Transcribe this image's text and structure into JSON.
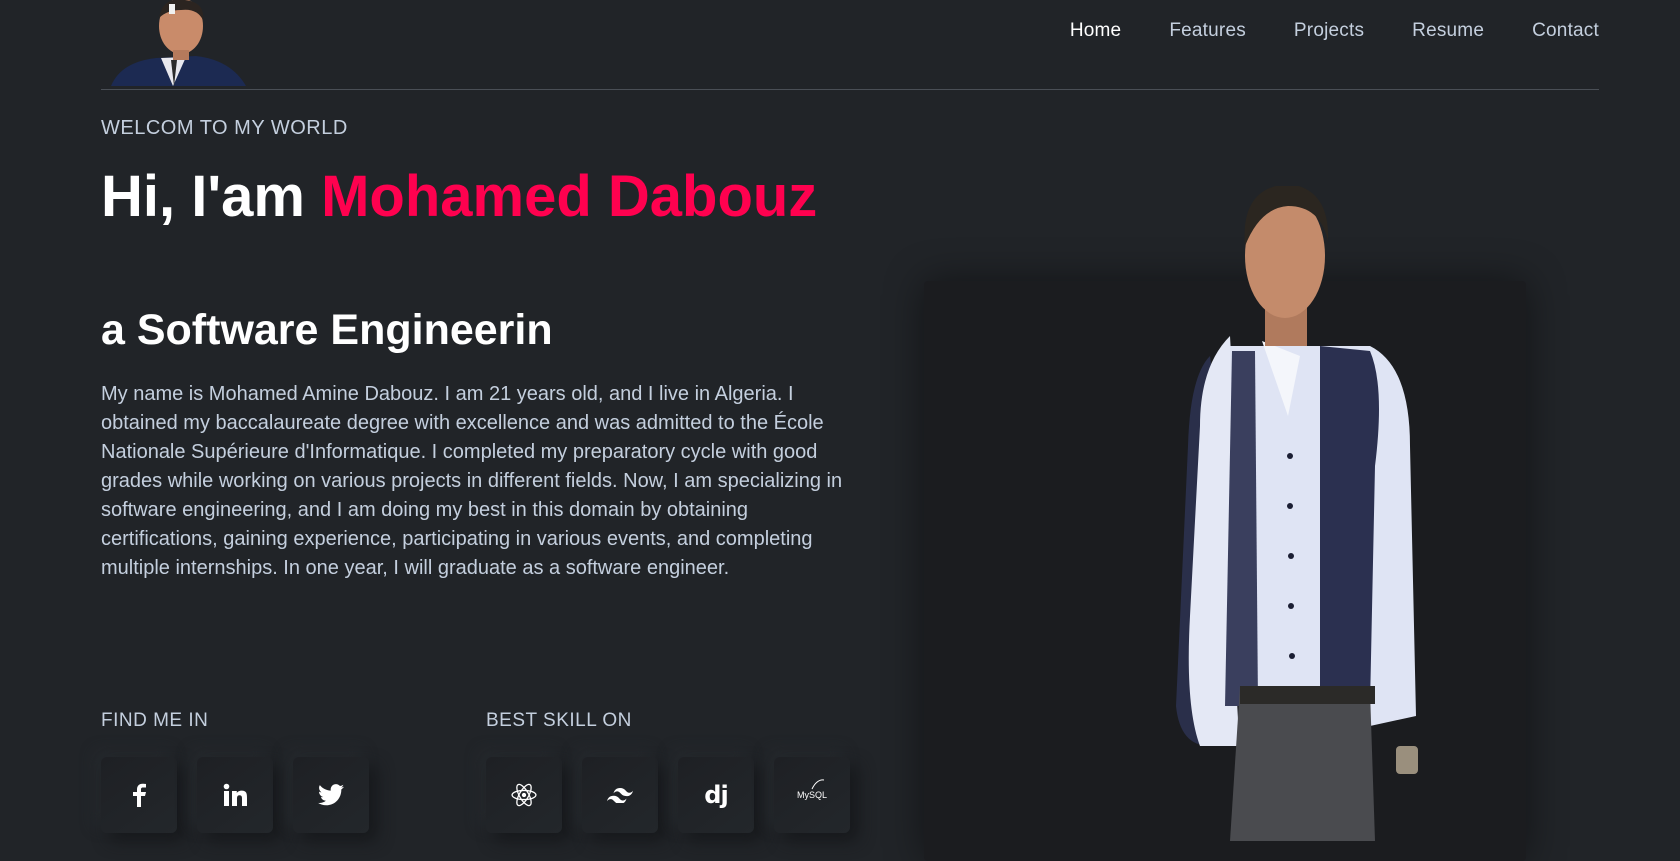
{
  "nav": {
    "items": [
      {
        "label": "Home",
        "active": true
      },
      {
        "label": "Features",
        "active": false
      },
      {
        "label": "Projects",
        "active": false
      },
      {
        "label": "Resume",
        "active": false
      },
      {
        "label": "Contact",
        "active": false
      }
    ]
  },
  "hero": {
    "welcome": "WELCOM TO MY WORLD",
    "greeting": "Hi, I'am ",
    "name": "Mohamed Dabouz",
    "subtitle": "a Software Engineerin",
    "bio": "My name is Mohamed Amine Dabouz. I am 21 years old, and I live in Algeria. I obtained my baccalaureate degree with excellence and was admitted to the École Nationale Supérieure d'Informatique. I completed my preparatory cycle with good grades while working on various projects in different fields. Now, I am specializing in software engineering, and I am doing my best in this domain by obtaining certifications, gaining experience, participating in various events, and completing multiple internships. In one year, I will graduate as a software engineer."
  },
  "social": {
    "label": "FIND ME IN",
    "items": [
      {
        "icon": "facebook-icon"
      },
      {
        "icon": "linkedin-icon"
      },
      {
        "icon": "twitter-icon"
      }
    ]
  },
  "skills": {
    "label": "BEST SKILL ON",
    "items": [
      {
        "icon": "react-icon"
      },
      {
        "icon": "tailwind-icon"
      },
      {
        "icon": "django-icon",
        "text": "dj"
      },
      {
        "icon": "mysql-icon",
        "text": "MySQL"
      }
    ]
  },
  "colors": {
    "background": "#212428",
    "accent": "#ff014f",
    "text": "#c4cfde",
    "heading": "#ffffff"
  }
}
